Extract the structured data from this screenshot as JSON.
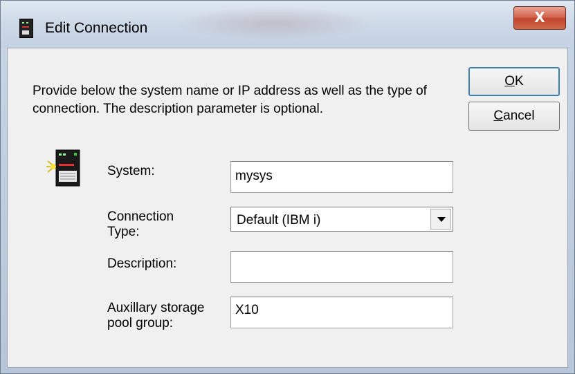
{
  "window": {
    "title": "Edit Connection",
    "close_label": "X"
  },
  "instructions": "Provide below the system name or IP address as well as the type of connection.  The description parameter is optional.",
  "buttons": {
    "ok": {
      "mnemonic": "O",
      "rest": "K"
    },
    "cancel": {
      "mnemonic": "C",
      "rest": "ancel"
    }
  },
  "form": {
    "system": {
      "label": "System:",
      "value": "mysys"
    },
    "connection_type": {
      "label_line1": "Connection",
      "label_line2": "Type:",
      "value": "Default (IBM i)"
    },
    "description": {
      "label": "Description:",
      "value": ""
    },
    "asp_group": {
      "label_line1": "Auxillary storage",
      "label_line2": "pool group:",
      "value": "X10"
    }
  },
  "icons": {
    "app": "system-icon",
    "form": "server-connection-icon",
    "dropdown": "chevron-down-icon"
  }
}
